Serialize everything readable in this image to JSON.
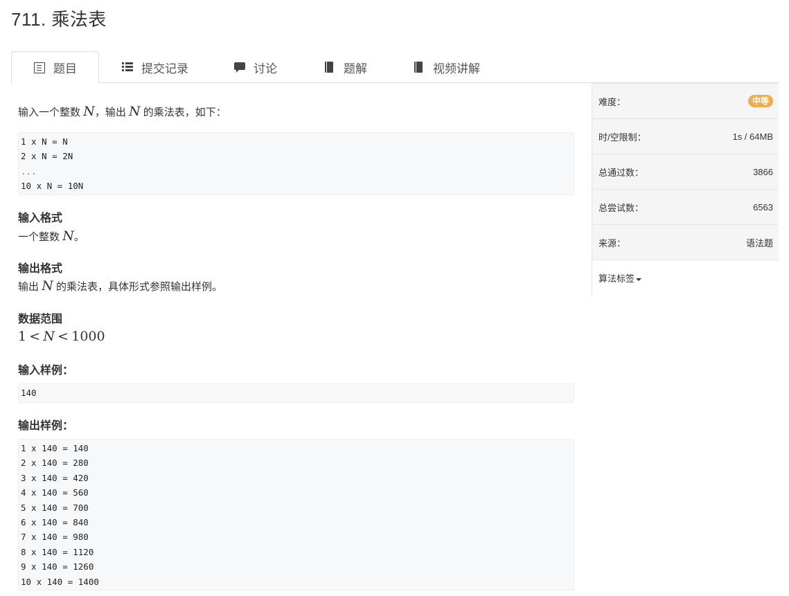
{
  "title": "711. 乘法表",
  "tabs": [
    {
      "label": "题目",
      "icon": "document-icon",
      "active": true
    },
    {
      "label": "提交记录",
      "icon": "list-icon"
    },
    {
      "label": "讨论",
      "icon": "comment-icon"
    },
    {
      "label": "题解",
      "icon": "book-icon"
    },
    {
      "label": "视频讲解",
      "icon": "book-icon"
    }
  ],
  "problem": {
    "intro_pre": "输入一个整数",
    "intro_var1": "N",
    "intro_mid": "，输出",
    "intro_var2": "N",
    "intro_post": "的乘法表，如下：",
    "example_lines": [
      "1 x N = N",
      "2 x N = 2N",
      "...",
      "10 x N = 10N"
    ],
    "input_format_title": "输入格式",
    "input_format_pre": "一个整数",
    "input_format_var": "N",
    "input_format_post": "。",
    "output_format_title": "输出格式",
    "output_format_pre": "输出",
    "output_format_var": "N",
    "output_format_post": "的乘法表，具体形式参照输出样例。",
    "range_title": "数据范围",
    "range_a": "1",
    "range_lt1": "<",
    "range_var": "N",
    "range_lt2": "<",
    "range_b": "1000",
    "input_sample_title": "输入样例：",
    "input_sample": "140",
    "output_sample_title": "输出样例：",
    "output_sample_lines": [
      "1 x 140 = 140",
      "2 x 140 = 280",
      "3 x 140 = 420",
      "4 x 140 = 560",
      "5 x 140 = 700",
      "6 x 140 = 840",
      "7 x 140 = 980",
      "8 x 140 = 1120",
      "9 x 140 = 1260",
      "10 x 140 = 1400"
    ]
  },
  "sidebar": {
    "difficulty_label": "难度：",
    "difficulty_value": "中等",
    "limit_label": "时/空限制：",
    "limit_value": "1s / 64MB",
    "passed_label": "总通过数：",
    "passed_value": "3866",
    "tried_label": "总尝试数：",
    "tried_value": "6563",
    "source_label": "来源：",
    "source_value": "语法题",
    "tags_label": "算法标签"
  },
  "colors": {
    "badge": "#f0ad4e",
    "code_bg": "#f6f8fa",
    "sidebar_bg": "#f5f5f5"
  }
}
